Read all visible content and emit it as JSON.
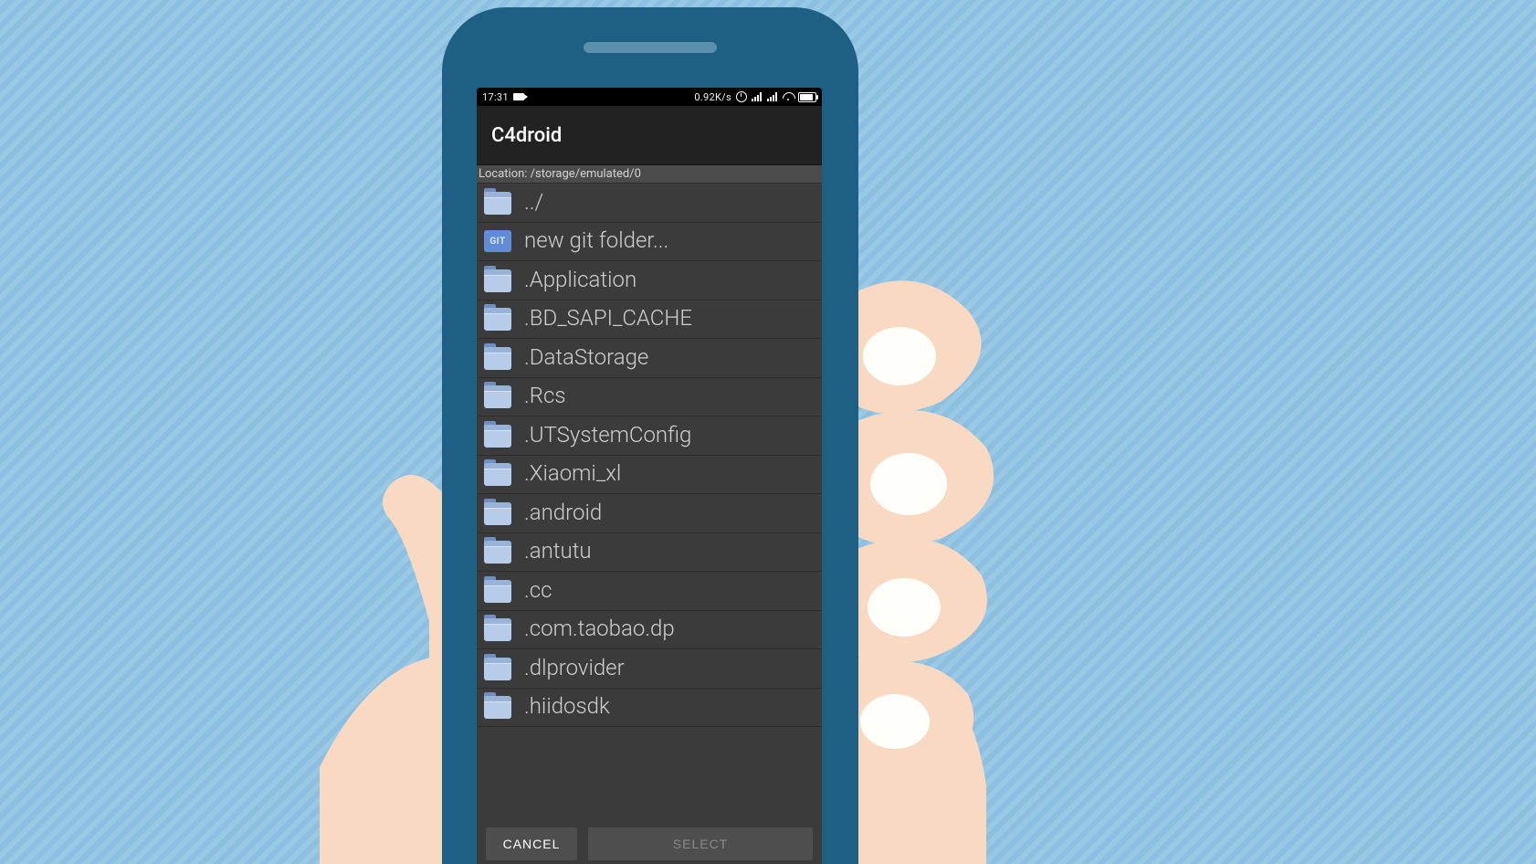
{
  "statusbar": {
    "time": "17:31",
    "net_speed": "0.92K/s"
  },
  "app": {
    "title": "C4droid",
    "location_label": "Location: /storage/emulated/0"
  },
  "entries": [
    {
      "icon": "folder",
      "label": "../"
    },
    {
      "icon": "git",
      "label": "new git folder...",
      "git_badge": "GIT"
    },
    {
      "icon": "folder",
      "label": ".Application"
    },
    {
      "icon": "folder",
      "label": ".BD_SAPI_CACHE"
    },
    {
      "icon": "folder",
      "label": ".DataStorage"
    },
    {
      "icon": "folder",
      "label": ".Rcs"
    },
    {
      "icon": "folder",
      "label": ".UTSystemConfig"
    },
    {
      "icon": "folder",
      "label": ".Xiaomi_xl"
    },
    {
      "icon": "folder",
      "label": ".android"
    },
    {
      "icon": "folder",
      "label": ".antutu"
    },
    {
      "icon": "folder",
      "label": ".cc"
    },
    {
      "icon": "folder",
      "label": ".com.taobao.dp"
    },
    {
      "icon": "folder",
      "label": ".dlprovider"
    },
    {
      "icon": "folder",
      "label": ".hiidosdk"
    }
  ],
  "buttons": {
    "cancel": "CANCEL",
    "select": "SELECT"
  }
}
